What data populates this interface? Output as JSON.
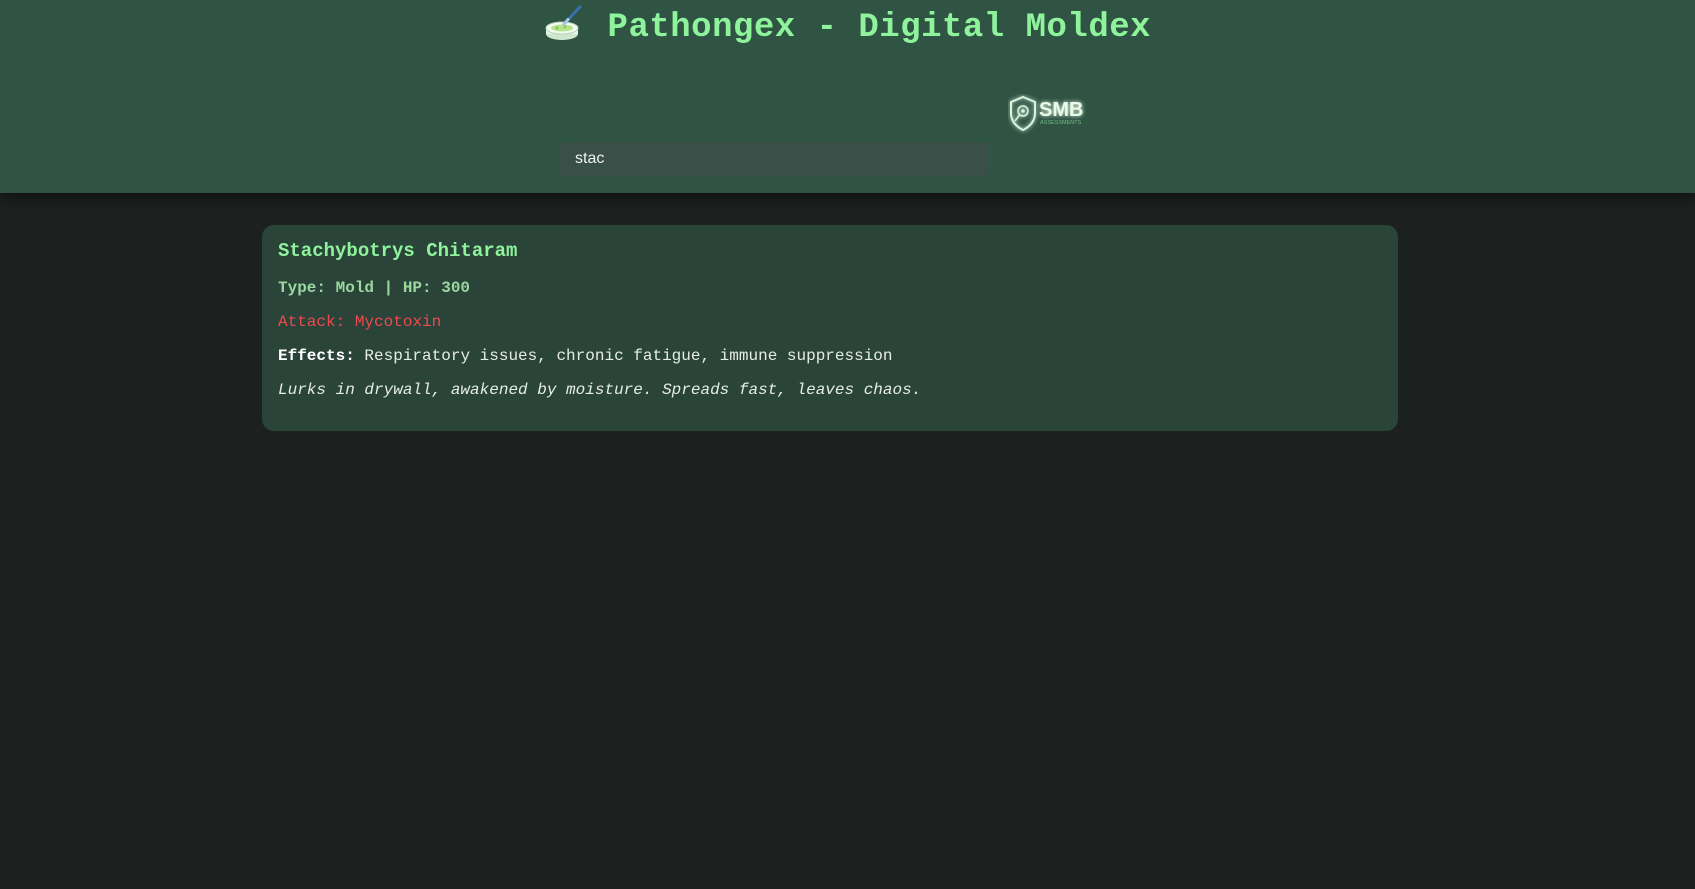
{
  "header": {
    "title_icon": "petri-dish-icon",
    "title": "Pathongex - Digital Moldex",
    "logo": {
      "name": "smb-logo",
      "text": "SMB",
      "subtext": "ASSESSMENTS"
    },
    "search": {
      "value": "stac",
      "placeholder": ""
    }
  },
  "result": {
    "name": "Stachybotrys Chitaram",
    "type_line": "Type: Mold | HP: 300",
    "attack_label": "Attack:",
    "attack_value": "Mycotoxin",
    "effects_label": "Effects:",
    "effects_value": "Respiratory issues, chronic fatigue, immune suppression",
    "flavor": "Lurks in drywall, awakened by moisture. Spreads fast, leaves chaos."
  },
  "colors": {
    "header_bg": "#2f5444",
    "page_bg": "#1c2120",
    "card_bg": "#2b4439",
    "accent_green": "#8ef39a",
    "attack_red": "#ee4a4a"
  }
}
